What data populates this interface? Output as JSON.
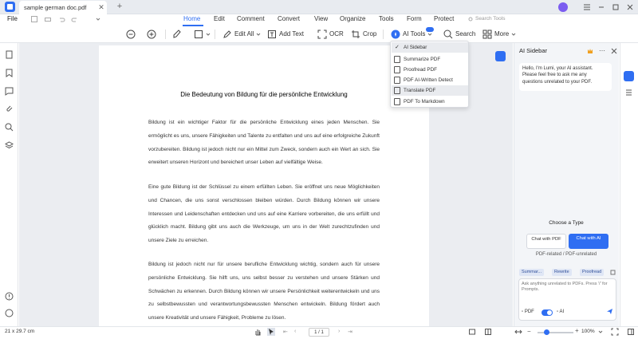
{
  "titlebar": {
    "doc_tab": "sample german doc.pdf",
    "close_glyph": "✕",
    "new_tab_glyph": "+"
  },
  "menu": {
    "file": "File",
    "tabs": [
      "Home",
      "Edit",
      "Comment",
      "Convert",
      "View",
      "Organize",
      "Tools",
      "Form",
      "Protect"
    ],
    "search_placeholder": "Search Tools"
  },
  "toolbar": {
    "edit_all": "Edit All",
    "add_text": "Add Text",
    "ocr": "OCR",
    "crop": "Crop",
    "ai_tools": "AI Tools",
    "search": "Search",
    "more": "More"
  },
  "ai_menu": {
    "items": [
      "AI Sidebar",
      "Summarize PDF",
      "Proofread PDF",
      "PDF AI-Written Detect",
      "Translate PDF",
      "PDF To Markdown"
    ],
    "checked": "AI Sidebar",
    "highlighted": "Translate PDF"
  },
  "document": {
    "title": "Die Bedeutung von Bildung für die persönliche Entwicklung",
    "paragraphs": [
      "Bildung ist ein wichtiger Faktor für die persönliche Entwicklung eines jeden Menschen. Sie ermöglicht es uns, unsere Fähigkeiten und Talente zu entfalten und uns auf eine erfolgreiche Zukunft vorzubereiten. Bildung ist jedoch nicht nur ein Mittel zum Zweck, sondern auch ein Wert an sich. Sie erweitert unseren Horizont und bereichert unser Leben auf vielfältige Weise.",
      "Eine gute Bildung ist der Schlüssel zu einem erfüllten Leben. Sie eröffnet uns neue Möglichkeiten und Chancen, die uns sonst verschlossen bleiben würden. Durch Bildung können wir unsere Interessen und Leidenschaften entdecken und uns auf eine Karriere vorbereiten, die uns erfüllt und glücklich macht. Bildung gibt uns auch die Werkzeuge, um uns in der Welt zurechtzufinden und unsere Ziele zu erreichen.",
      "Bildung ist jedoch nicht nur für unsere berufliche Entwicklung wichtig, sondern auch für unsere persönliche Entwicklung. Sie hilft uns, uns selbst besser zu verstehen und unsere Stärken und Schwächen zu erkennen. Durch Bildung können wir unsere Persönlichkeit weiterentwickeln und uns zu selbstbewussten und verantwortungsbewussten Menschen entwickeln. Bildung fördert auch unsere Kreativität und unsere Fähigkeit, Probleme zu lösen."
    ]
  },
  "ai_sidebar": {
    "title": "AI Sidebar",
    "greeting": "Hello, I'm Lumi, your AI assistant. Please feel free to ask me any questions unrelated to your PDF.",
    "choose_type": "Choose a Type",
    "type_chat_pdf": "Chat with PDF",
    "type_chat_ai": "Chat with AI",
    "type_hint": "PDF-related / PDF-unrelated",
    "chips": [
      "Summar...",
      "Rewrite",
      "Proofread"
    ],
    "input_placeholder": "Ask anything unrelated to PDFs. Press '/' for Prompts.",
    "pdf_toggle": "PDF",
    "ai_toggle": "AI",
    "ai_toggle_on": true
  },
  "status": {
    "page_size": "21 x 29.7 cm",
    "page_indicator": "1 / 1",
    "zoom": "100%",
    "zoom_fraction": 0.25
  },
  "colors": {
    "accent": "#2f6ef2",
    "canvas": "#ebedf1"
  }
}
